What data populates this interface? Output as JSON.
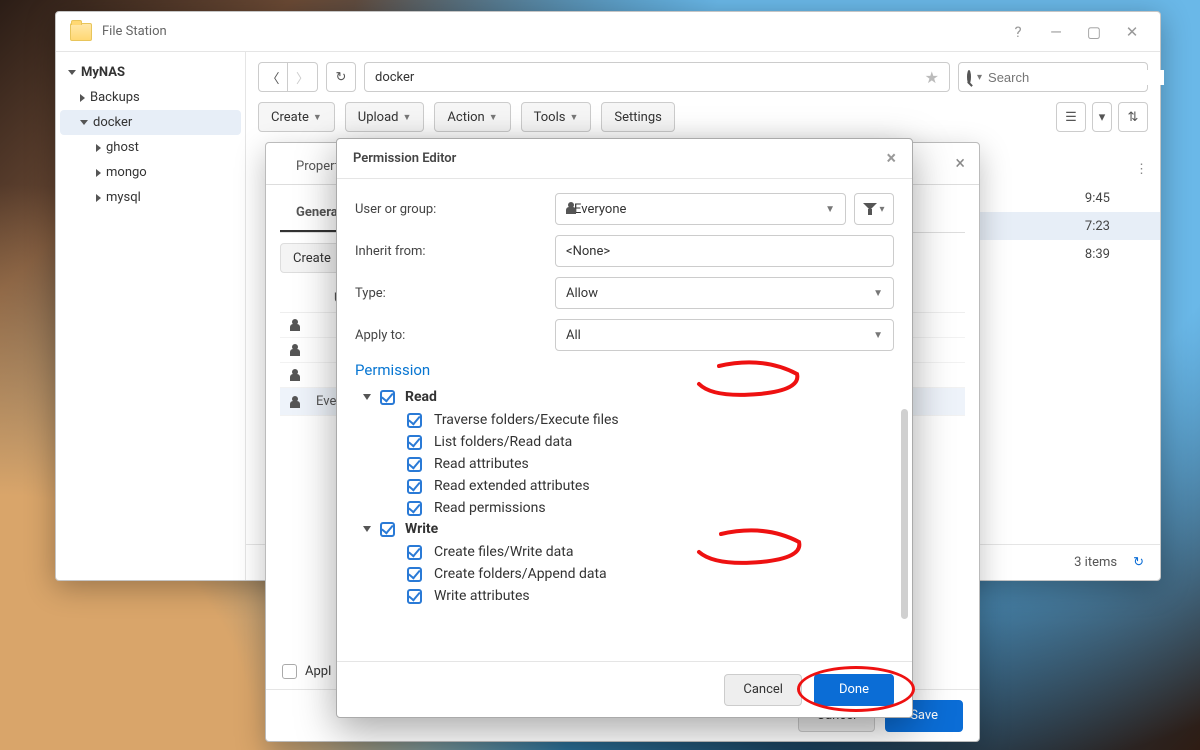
{
  "window": {
    "title": "File Station"
  },
  "sidebar": {
    "root": "MyNAS",
    "items": [
      "Backups",
      "docker",
      "ghost",
      "mongo",
      "mysql"
    ],
    "selected": "docker"
  },
  "address": {
    "path": "docker"
  },
  "search": {
    "placeholder": "Search"
  },
  "toolbar": {
    "create": "Create",
    "upload": "Upload",
    "action": "Action",
    "tools": "Tools",
    "settings": "Settings"
  },
  "file_times": [
    "9:45",
    "7:23",
    "8:39"
  ],
  "footer": {
    "count_label": "3 items"
  },
  "props": {
    "title_prefix": "Propertie",
    "tabs": {
      "general": "General"
    },
    "create_btn": "Create",
    "col_user": "Use",
    "rows": [
      "",
      "",
      "",
      "Eve"
    ],
    "apply_label": "Appl",
    "cancel": "Cancel",
    "save": "Save"
  },
  "pedit": {
    "title": "Permission Editor",
    "labels": {
      "user_or_group": "User or group:",
      "inherit_from": "Inherit from:",
      "type": "Type:",
      "apply_to": "Apply to:",
      "permission": "Permission"
    },
    "values": {
      "user_or_group": "Everyone",
      "inherit_from": "<None>",
      "type": "Allow",
      "apply_to": "All"
    },
    "groups": {
      "read": {
        "label": "Read",
        "items": [
          "Traverse folders/Execute files",
          "List folders/Read data",
          "Read attributes",
          "Read extended attributes",
          "Read permissions"
        ]
      },
      "write": {
        "label": "Write",
        "items": [
          "Create files/Write data",
          "Create folders/Append data",
          "Write attributes"
        ]
      }
    },
    "buttons": {
      "cancel": "Cancel",
      "done": "Done"
    }
  }
}
